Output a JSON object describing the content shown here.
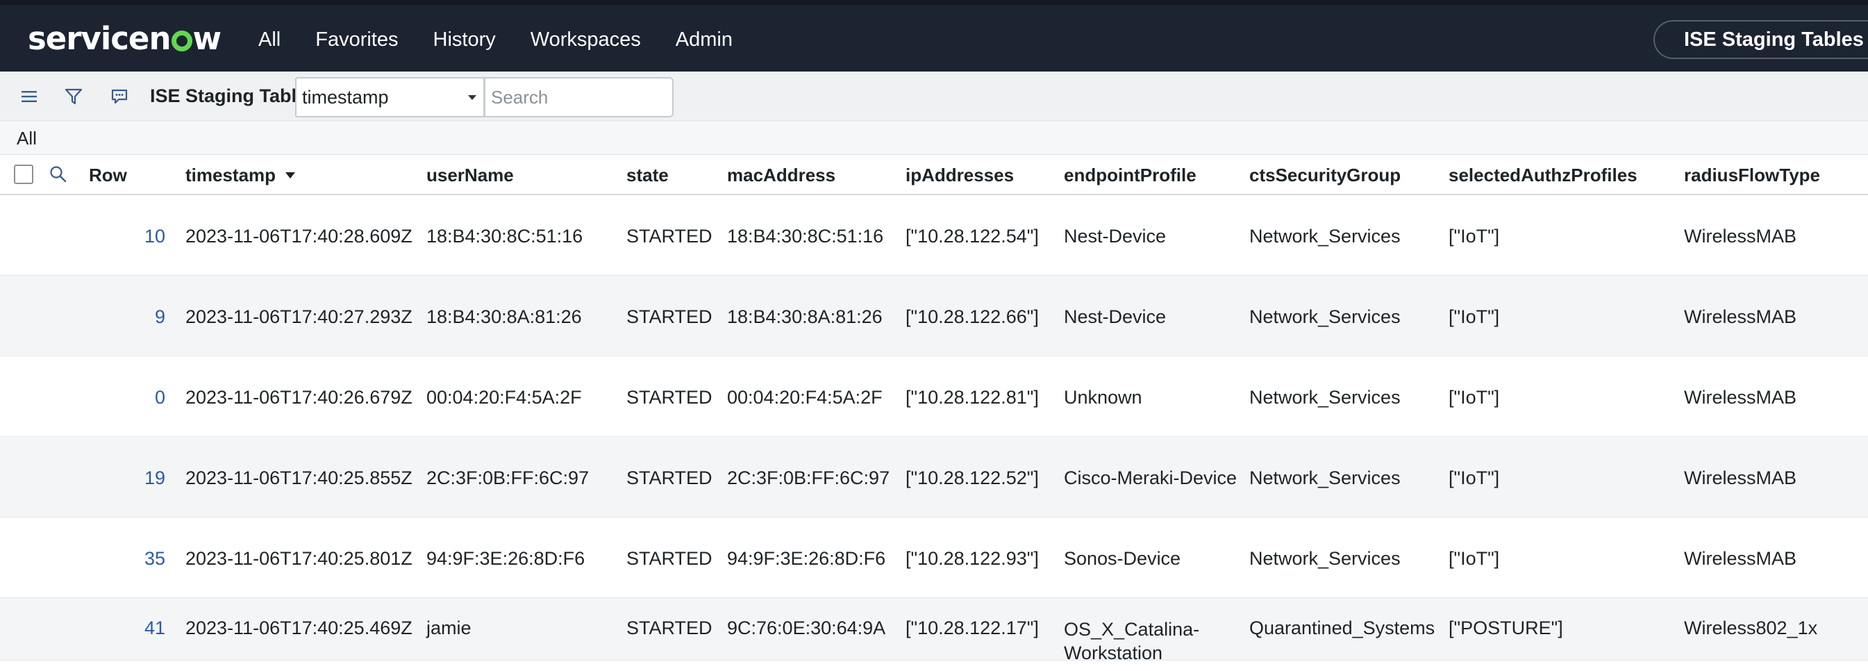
{
  "brand": {
    "logo_text_before": "servicen",
    "logo_text_after": "w",
    "accent": "#62d84e"
  },
  "nav": {
    "items": [
      "All",
      "Favorites",
      "History",
      "Workspaces",
      "Admin"
    ],
    "context_title": "ISE Staging Tables",
    "star_icon": "star-icon"
  },
  "toolbar": {
    "menu_icon": "hamburger-menu-icon",
    "filter_icon": "filter-icon",
    "chat_icon": "chat-bubble-icon",
    "title": "ISE Staging Tables",
    "search_field": "timestamp",
    "search_placeholder": "Search"
  },
  "breadcrumb": {
    "label": "All"
  },
  "table": {
    "columns": {
      "row": "Row",
      "timestamp": "timestamp",
      "userName": "userName",
      "state": "state",
      "macAddress": "macAddress",
      "ipAddresses": "ipAddresses",
      "endpointProfile": "endpointProfile",
      "ctsSecurityGroup": "ctsSecurityGroup",
      "selectedAuthzProfiles": "selectedAuthzProfiles",
      "radiusFlowType": "radiusFlowType"
    },
    "sorted_by": "timestamp",
    "sort_direction": "descending",
    "rows": [
      {
        "row": "10",
        "timestamp": "2023-11-06T17:40:28.609Z",
        "userName": "18:B4:30:8C:51:16",
        "state": "STARTED",
        "macAddress": "18:B4:30:8C:51:16",
        "ipAddresses": "[\"10.28.122.54\"]",
        "endpointProfile": "Nest-Device",
        "ctsSecurityGroup": "Network_Services",
        "selectedAuthzProfiles": "[\"IoT\"]",
        "radiusFlowType": "WirelessMAB"
      },
      {
        "row": "9",
        "timestamp": "2023-11-06T17:40:27.293Z",
        "userName": "18:B4:30:8A:81:26",
        "state": "STARTED",
        "macAddress": "18:B4:30:8A:81:26",
        "ipAddresses": "[\"10.28.122.66\"]",
        "endpointProfile": "Nest-Device",
        "ctsSecurityGroup": "Network_Services",
        "selectedAuthzProfiles": "[\"IoT\"]",
        "radiusFlowType": "WirelessMAB"
      },
      {
        "row": "0",
        "timestamp": "2023-11-06T17:40:26.679Z",
        "userName": "00:04:20:F4:5A:2F",
        "state": "STARTED",
        "macAddress": "00:04:20:F4:5A:2F",
        "ipAddresses": "[\"10.28.122.81\"]",
        "endpointProfile": "Unknown",
        "ctsSecurityGroup": "Network_Services",
        "selectedAuthzProfiles": "[\"IoT\"]",
        "radiusFlowType": "WirelessMAB"
      },
      {
        "row": "19",
        "timestamp": "2023-11-06T17:40:25.855Z",
        "userName": "2C:3F:0B:FF:6C:97",
        "state": "STARTED",
        "macAddress": "2C:3F:0B:FF:6C:97",
        "ipAddresses": "[\"10.28.122.52\"]",
        "endpointProfile": "Cisco-Meraki-Device",
        "ctsSecurityGroup": "Network_Services",
        "selectedAuthzProfiles": "[\"IoT\"]",
        "radiusFlowType": "WirelessMAB"
      },
      {
        "row": "35",
        "timestamp": "2023-11-06T17:40:25.801Z",
        "userName": "94:9F:3E:26:8D:F6",
        "state": "STARTED",
        "macAddress": "94:9F:3E:26:8D:F6",
        "ipAddresses": "[\"10.28.122.93\"]",
        "endpointProfile": "Sonos-Device",
        "ctsSecurityGroup": "Network_Services",
        "selectedAuthzProfiles": "[\"IoT\"]",
        "radiusFlowType": "WirelessMAB"
      },
      {
        "row": "41",
        "timestamp": "2023-11-06T17:40:25.469Z",
        "userName": "jamie",
        "state": "STARTED",
        "macAddress": "9C:76:0E:30:64:9A",
        "ipAddresses": "[\"10.28.122.17\"]",
        "endpointProfile": "OS_X_Catalina-Workstation",
        "ctsSecurityGroup": "Quarantined_Systems",
        "selectedAuthzProfiles": "[\"POSTURE\"]",
        "radiusFlowType": "Wireless802_1x"
      }
    ]
  }
}
